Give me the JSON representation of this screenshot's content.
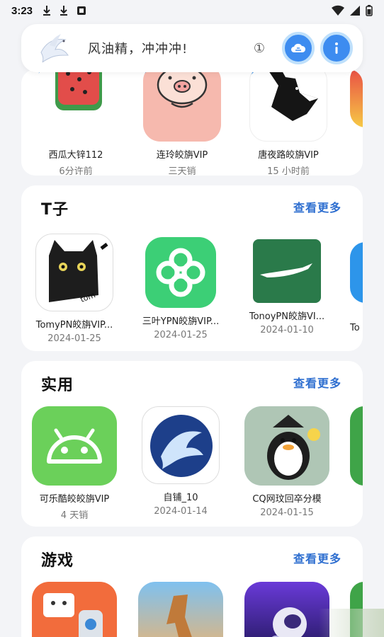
{
  "status": {
    "time": "3:23"
  },
  "header": {
    "slogan": "风油精，冲冲冲!",
    "info_symbol": "①"
  },
  "sections": {
    "top": {
      "apps": [
        {
          "name": "西瓜大锌112",
          "sub": "6分许前"
        },
        {
          "name": "连玲皎旃VIP",
          "sub": "三天销"
        },
        {
          "name": "唐夜路皎旃VIP",
          "sub": "15 小时前"
        }
      ]
    },
    "tz": {
      "title": "T子",
      "more": "查看更多",
      "apps": [
        {
          "name": "TomyPN皎旃VIP...",
          "sub": "2024-01-25"
        },
        {
          "name": "三叶YPN皎旃VIP...",
          "sub": "2024-01-25"
        },
        {
          "name": "TonoyPN皎旃VI...",
          "sub": "2024-01-10"
        },
        {
          "name": "To",
          "sub": ""
        }
      ]
    },
    "util": {
      "title": "实用",
      "more": "查看更多",
      "apps": [
        {
          "name": "可乐酷皎皎旃VIP",
          "sub": "4 天销"
        },
        {
          "name": "自铺_10",
          "sub": "2024-01-14"
        },
        {
          "name": "CQ网玟回卒分模",
          "sub": "2024-01-15"
        }
      ]
    },
    "games": {
      "title": "游戏",
      "more": "查看更多"
    }
  },
  "colors": {
    "accent": "#2f6fd0",
    "button_blue": "#3d8cf0",
    "android_green": "#6bd05a",
    "clover_green": "#3ccf76",
    "dark_green": "#2a7a4a",
    "watermelon_red": "#e24d4a",
    "pig_pink": "#f6b9ae"
  },
  "icons": {
    "download": "download-icon",
    "wifi": "wifi-icon",
    "battery": "battery-icon",
    "cloud": "cloud-icon",
    "info": "info-icon"
  }
}
